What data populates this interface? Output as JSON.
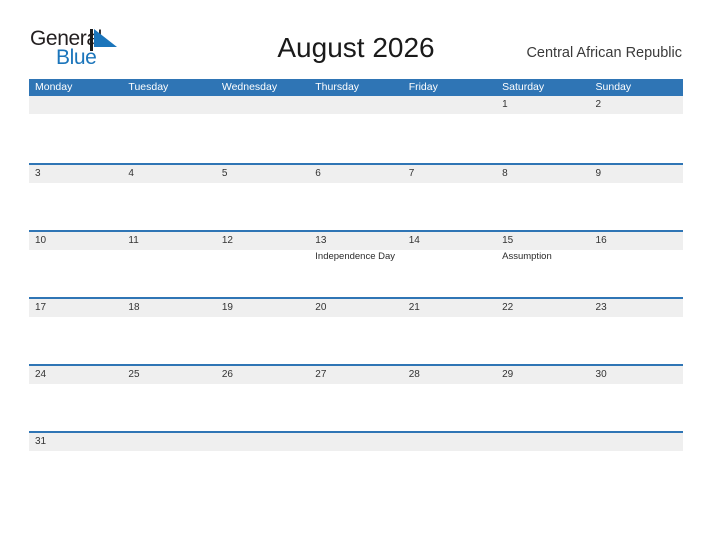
{
  "logo": {
    "word_one": "General",
    "word_two": "Blue",
    "flag_icon": "flag-triangle-icon",
    "color_dark": "#231f20",
    "color_blue": "#1b75bb"
  },
  "header": {
    "title": "August 2026",
    "country": "Central African Republic"
  },
  "theme": {
    "header_blue": "#2f75b5",
    "number_band": "#efefef",
    "separator_blue": "#2f75b5"
  },
  "calendar": {
    "day_headers": [
      "Monday",
      "Tuesday",
      "Wednesday",
      "Thursday",
      "Friday",
      "Saturday",
      "Sunday"
    ],
    "weeks": [
      {
        "days": [
          {
            "number": "",
            "event": ""
          },
          {
            "number": "",
            "event": ""
          },
          {
            "number": "",
            "event": ""
          },
          {
            "number": "",
            "event": ""
          },
          {
            "number": "",
            "event": ""
          },
          {
            "number": "1",
            "event": ""
          },
          {
            "number": "2",
            "event": ""
          }
        ]
      },
      {
        "days": [
          {
            "number": "3",
            "event": ""
          },
          {
            "number": "4",
            "event": ""
          },
          {
            "number": "5",
            "event": ""
          },
          {
            "number": "6",
            "event": ""
          },
          {
            "number": "7",
            "event": ""
          },
          {
            "number": "8",
            "event": ""
          },
          {
            "number": "9",
            "event": ""
          }
        ]
      },
      {
        "days": [
          {
            "number": "10",
            "event": ""
          },
          {
            "number": "11",
            "event": ""
          },
          {
            "number": "12",
            "event": ""
          },
          {
            "number": "13",
            "event": "Independence Day"
          },
          {
            "number": "14",
            "event": ""
          },
          {
            "number": "15",
            "event": "Assumption"
          },
          {
            "number": "16",
            "event": ""
          }
        ]
      },
      {
        "days": [
          {
            "number": "17",
            "event": ""
          },
          {
            "number": "18",
            "event": ""
          },
          {
            "number": "19",
            "event": ""
          },
          {
            "number": "20",
            "event": ""
          },
          {
            "number": "21",
            "event": ""
          },
          {
            "number": "22",
            "event": ""
          },
          {
            "number": "23",
            "event": ""
          }
        ]
      },
      {
        "days": [
          {
            "number": "24",
            "event": ""
          },
          {
            "number": "25",
            "event": ""
          },
          {
            "number": "26",
            "event": ""
          },
          {
            "number": "27",
            "event": ""
          },
          {
            "number": "28",
            "event": ""
          },
          {
            "number": "29",
            "event": ""
          },
          {
            "number": "30",
            "event": ""
          }
        ]
      },
      {
        "days": [
          {
            "number": "31",
            "event": ""
          },
          {
            "number": "",
            "event": ""
          },
          {
            "number": "",
            "event": ""
          },
          {
            "number": "",
            "event": ""
          },
          {
            "number": "",
            "event": ""
          },
          {
            "number": "",
            "event": ""
          },
          {
            "number": "",
            "event": ""
          }
        ]
      }
    ]
  }
}
